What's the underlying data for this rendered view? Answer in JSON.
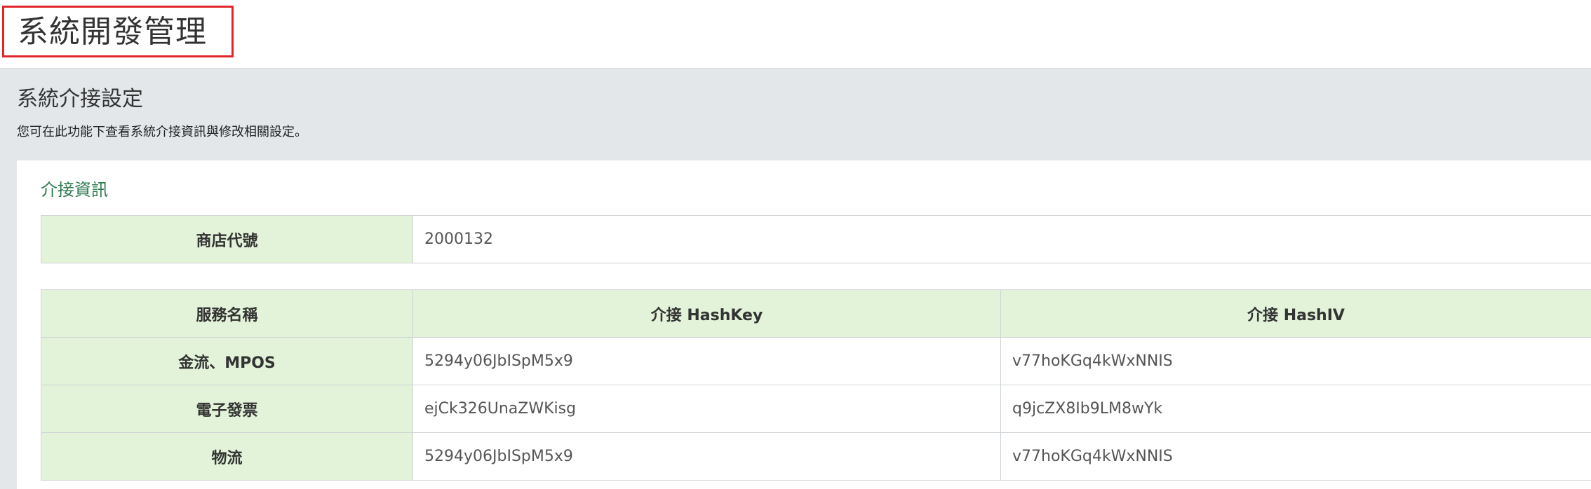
{
  "header": {
    "title": "系統開發管理"
  },
  "section": {
    "title": "系統介接設定",
    "description": "您可在此功能下查看系統介接資訊與修改相關設定。"
  },
  "panel": {
    "title": "介接資訊",
    "store": {
      "label": "商店代號",
      "value": "2000132"
    },
    "keys_table": {
      "headers": [
        "服務名稱",
        "介接 HashKey",
        "介接 HashIV"
      ],
      "rows": [
        [
          "金流、MPOS",
          "5294y06JbISpM5x9",
          "v77hoKGq4kWxNNIS"
        ],
        [
          "電子發票",
          "ejCk326UnaZWKisg",
          "q9jcZX8Ib9LM8wYk"
        ],
        [
          "物流",
          "5294y06JbISpM5x9",
          "v77hoKGq4kWxNNIS"
        ]
      ]
    }
  },
  "colors": {
    "highlight_border": "#e0262a",
    "label_bg": "#e2f3d9",
    "panel_title": "#2f7a4e",
    "page_bg": "#e3e7ea"
  }
}
